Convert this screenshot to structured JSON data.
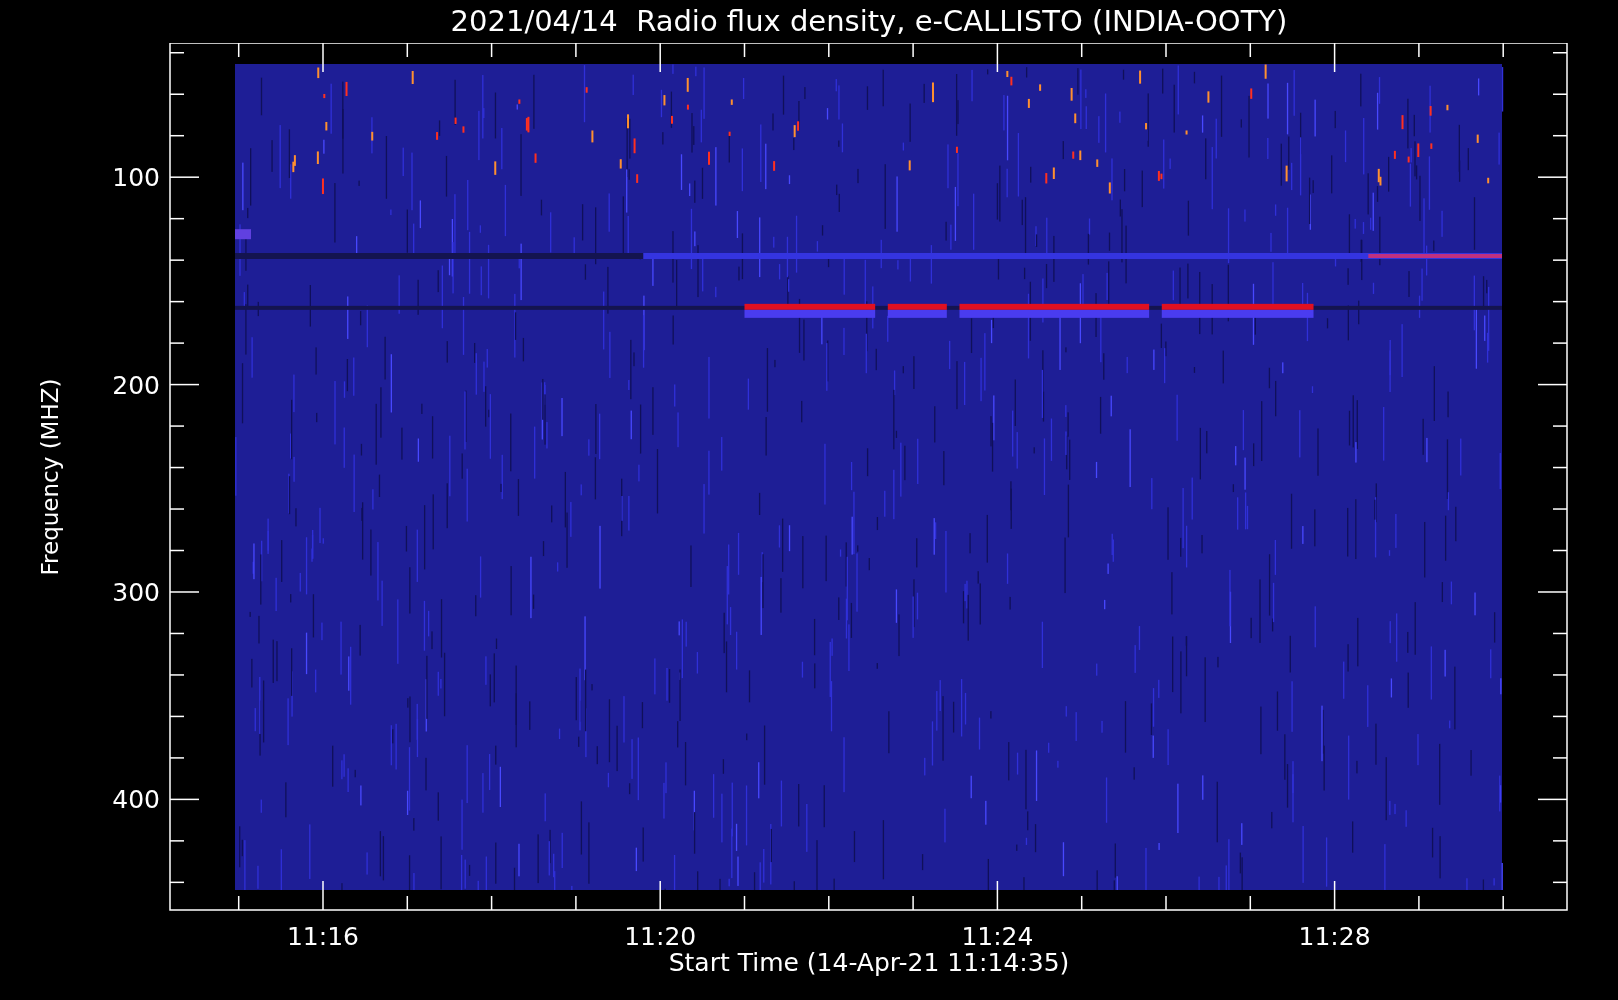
{
  "title": "2021/04/14  Radio flux density, e-CALLISTO (INDIA-OOTY)",
  "y_axis": {
    "label": "Frequency (MHZ)",
    "ticks": [
      "100",
      "200",
      "300",
      "400"
    ]
  },
  "x_axis": {
    "label": "Start Time (14-Apr-21 11:14:35)",
    "ticks": [
      "11:16",
      "11:20",
      "11:24",
      "11:28"
    ]
  }
}
